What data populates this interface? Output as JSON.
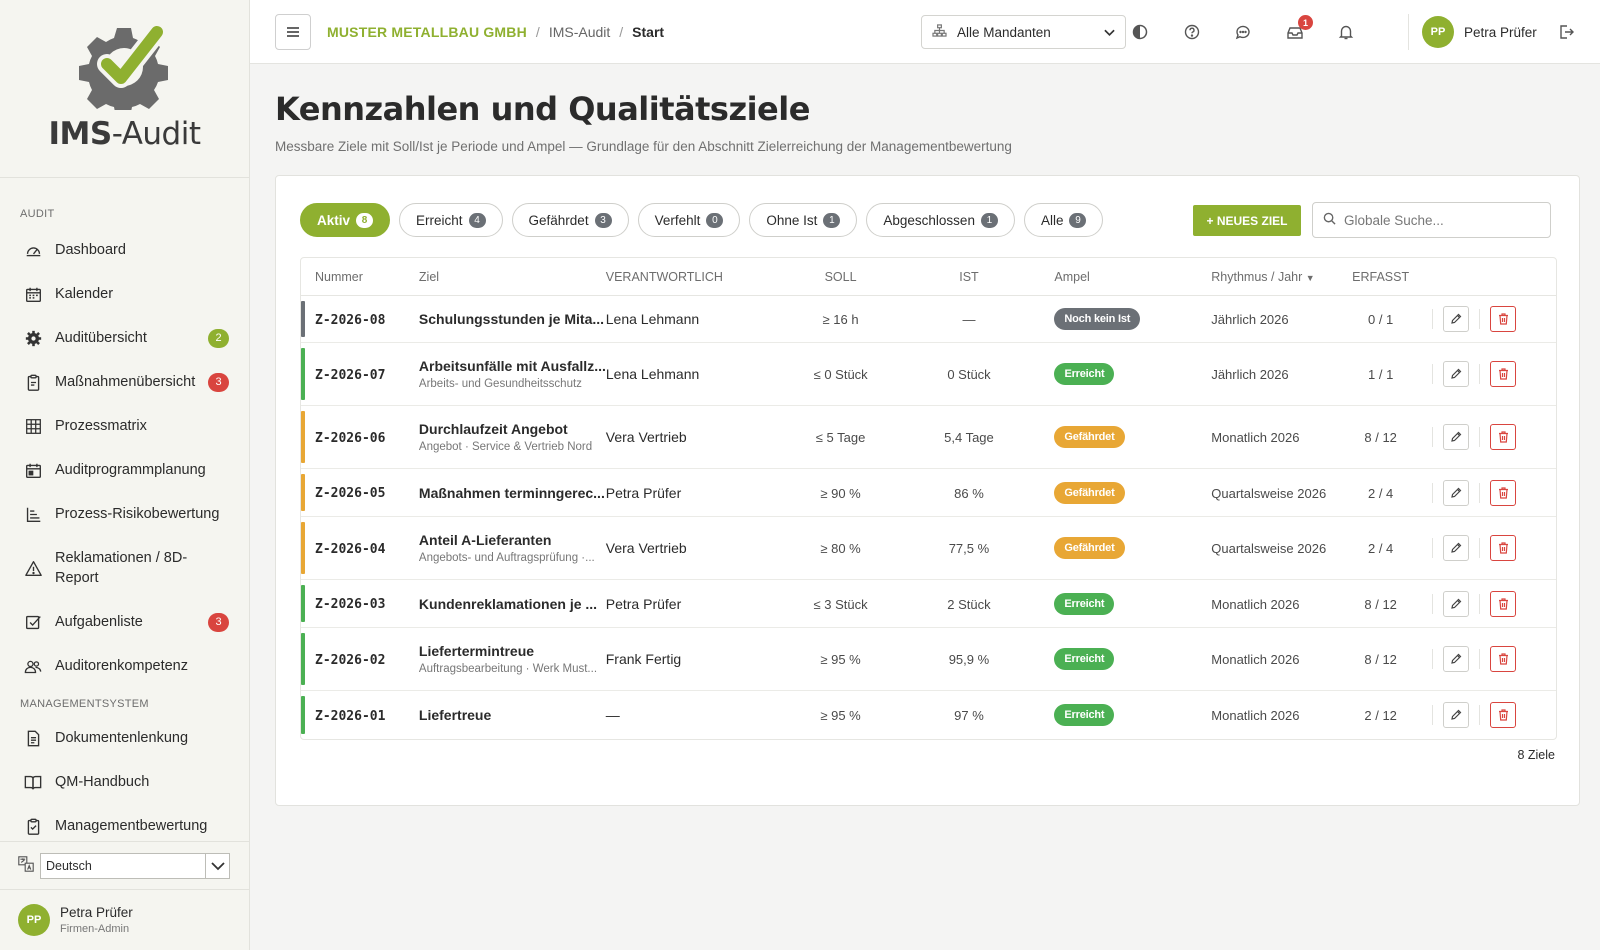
{
  "app": {
    "logo_bold": "IMS",
    "logo_rest": "-Audit"
  },
  "sidebar": {
    "sections": [
      {
        "title": "Audit",
        "items": [
          {
            "label": "Dashboard",
            "icon": "gauge-icon"
          },
          {
            "label": "Kalender",
            "icon": "calendar-icon"
          },
          {
            "label": "Auditübersicht",
            "icon": "gear-icon",
            "badge": "2",
            "badge_color": "green"
          },
          {
            "label": "Maßnahmenübersicht",
            "icon": "clipboard-icon",
            "badge": "3",
            "badge_color": "red"
          },
          {
            "label": "Prozessmatrix",
            "icon": "grid-icon"
          },
          {
            "label": "Auditprogrammplanung",
            "icon": "calendar-plan-icon"
          },
          {
            "label": "Prozess-Risikobewertung",
            "icon": "hierarchy-icon"
          },
          {
            "label": "Reklamationen / 8D-Report",
            "icon": "warning-icon"
          },
          {
            "label": "Aufgabenliste",
            "icon": "checkbox-icon",
            "badge": "3",
            "badge_color": "red"
          },
          {
            "label": "Auditorenkompetenz",
            "icon": "users-icon"
          }
        ]
      },
      {
        "title": "Managementsystem",
        "items": [
          {
            "label": "Dokumentenlenkung",
            "icon": "document-icon"
          },
          {
            "label": "QM-Handbuch",
            "icon": "book-icon"
          },
          {
            "label": "Managementbewertung",
            "icon": "clipboard-check-icon"
          }
        ]
      }
    ],
    "language": "Deutsch",
    "user": {
      "initials": "PP",
      "name": "Petra Prüfer",
      "role": "Firmen-Admin"
    }
  },
  "topbar": {
    "company": "MUSTER METALLBAU GMBH",
    "crumb_mid": "IMS-Audit",
    "crumb_last": "Start",
    "tenant": "Alle Mandanten",
    "notification_count": "1",
    "user_initials": "PP",
    "user_name": "Petra Prüfer"
  },
  "page": {
    "title": "Kennzahlen und Qualitätsziele",
    "subtitle": "Messbare Ziele mit Soll/Ist je Periode und Ampel — Grundlage für den Abschnitt Zielerreichung der Managementbewertung"
  },
  "filters": [
    {
      "label": "Aktiv",
      "count": "8",
      "active": true
    },
    {
      "label": "Erreicht",
      "count": "4"
    },
    {
      "label": "Gefährdet",
      "count": "3"
    },
    {
      "label": "Verfehlt",
      "count": "0"
    },
    {
      "label": "Ohne Ist",
      "count": "1"
    },
    {
      "label": "Abgeschlossen",
      "count": "1"
    },
    {
      "label": "Alle",
      "count": "9"
    }
  ],
  "new_button": "+ NEUES ZIEL",
  "search_placeholder": "Globale Suche...",
  "columns": {
    "num": "Nummer",
    "ziel": "Ziel",
    "verant": "VERANTWORTLICH",
    "soll": "SOLL",
    "ist": "IST",
    "ampel": "Ampel",
    "rhythmus": "Rhythmus / Jahr",
    "erfasst": "ERFASST"
  },
  "colors": {
    "accent": "#8fb030",
    "danger": "#d9453f",
    "warning": "#e8a735",
    "success": "#4bb053",
    "neutral": "#6b7076"
  },
  "rows": [
    {
      "num": "Z-2026-08",
      "ziel": "Schulungsstunden je Mita...",
      "sub": "",
      "verant": "Lena Lehmann",
      "soll": "≥ 16 h",
      "ist": "—",
      "ampel": "Noch kein Ist",
      "ampel_color": "#6b7076",
      "rhythmus": "Jährlich 2026",
      "erfasst": "0 / 1"
    },
    {
      "num": "Z-2026-07",
      "ziel": "Arbeitsunfälle mit Ausfallz...",
      "sub": "Arbeits- und Gesundheitsschutz",
      "verant": "Lena Lehmann",
      "soll": "≤ 0 Stück",
      "ist": "0 Stück",
      "ampel": "Erreicht",
      "ampel_color": "#4bb053",
      "rhythmus": "Jährlich 2026",
      "erfasst": "1 / 1"
    },
    {
      "num": "Z-2026-06",
      "ziel": "Durchlaufzeit Angebot",
      "sub": "Angebot · Service & Vertrieb Nord",
      "verant": "Vera Vertrieb",
      "soll": "≤ 5 Tage",
      "ist": "5,4 Tage",
      "ampel": "Gefährdet",
      "ampel_color": "#e8a735",
      "rhythmus": "Monatlich 2026",
      "erfasst": "8 / 12"
    },
    {
      "num": "Z-2026-05",
      "ziel": "Maßnahmen terminngerec...",
      "sub": "",
      "verant": "Petra Prüfer",
      "soll": "≥ 90 %",
      "ist": "86 %",
      "ampel": "Gefährdet",
      "ampel_color": "#e8a735",
      "rhythmus": "Quartalsweise 2026",
      "erfasst": "2 / 4"
    },
    {
      "num": "Z-2026-04",
      "ziel": "Anteil A-Lieferanten",
      "sub": "Angebots- und Auftragsprüfung ·...",
      "verant": "Vera Vertrieb",
      "soll": "≥ 80 %",
      "ist": "77,5 %",
      "ampel": "Gefährdet",
      "ampel_color": "#e8a735",
      "rhythmus": "Quartalsweise 2026",
      "erfasst": "2 / 4"
    },
    {
      "num": "Z-2026-03",
      "ziel": "Kundenreklamationen je ...",
      "sub": "",
      "verant": "Petra Prüfer",
      "soll": "≤ 3 Stück",
      "ist": "2 Stück",
      "ampel": "Erreicht",
      "ampel_color": "#4bb053",
      "rhythmus": "Monatlich 2026",
      "erfasst": "8 / 12"
    },
    {
      "num": "Z-2026-02",
      "ziel": "Liefertermintreue",
      "sub": "Auftragsbearbeitung · Werk Must...",
      "verant": "Frank Fertig",
      "soll": "≥ 95 %",
      "ist": "95,9 %",
      "ampel": "Erreicht",
      "ampel_color": "#4bb053",
      "rhythmus": "Monatlich 2026",
      "erfasst": "8 / 12"
    },
    {
      "num": "Z-2026-01",
      "ziel": "Liefertreue",
      "sub": "",
      "verant": "—",
      "soll": "≥ 95 %",
      "ist": "97 %",
      "ampel": "Erreicht",
      "ampel_color": "#4bb053",
      "rhythmus": "Monatlich 2026",
      "erfasst": "2 / 12"
    }
  ],
  "footer_count": "8 Ziele"
}
